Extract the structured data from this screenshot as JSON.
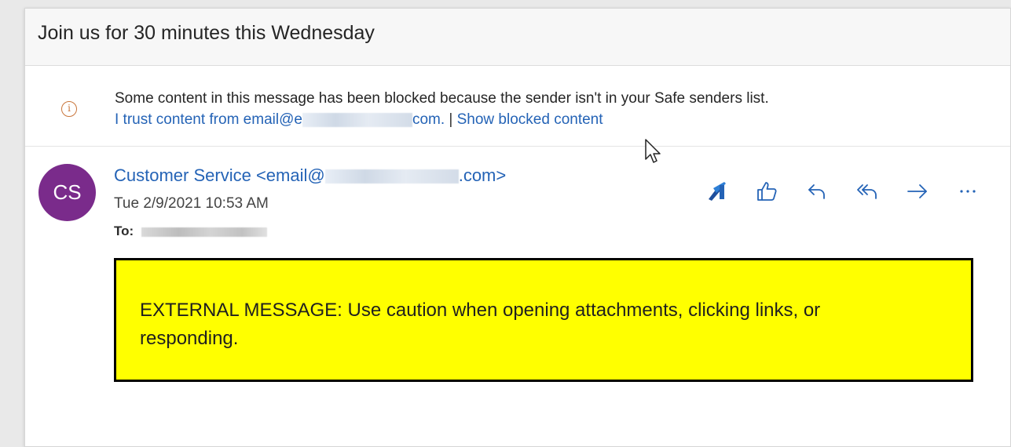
{
  "email": {
    "subject": "Join us for 30 minutes this Wednesday",
    "info_bar": {
      "message": "Some content in this message has been blocked because the sender isn't in your Safe senders list.",
      "trust_link_prefix": "I trust content from email@e",
      "trust_link_suffix": "com.",
      "separator": "|",
      "show_blocked_link": "Show blocked content"
    },
    "sender": {
      "avatar_initials": "CS",
      "name_prefix": "Customer Service <email@",
      "name_suffix": ".com>",
      "date": "Tue 2/9/2021 10:53 AM",
      "to_label": "To:"
    },
    "actions": [
      "sticker-icon",
      "like-icon",
      "reply-icon",
      "reply-all-icon",
      "forward-icon",
      "more-icon"
    ],
    "banner": {
      "text": "EXTERNAL MESSAGE: Use caution when opening attachments, clicking links, or responding."
    }
  },
  "colors": {
    "link": "#2463b6",
    "avatar": "#7a2b8b",
    "banner": "#ffff00",
    "info_icon": "#c9763c"
  }
}
